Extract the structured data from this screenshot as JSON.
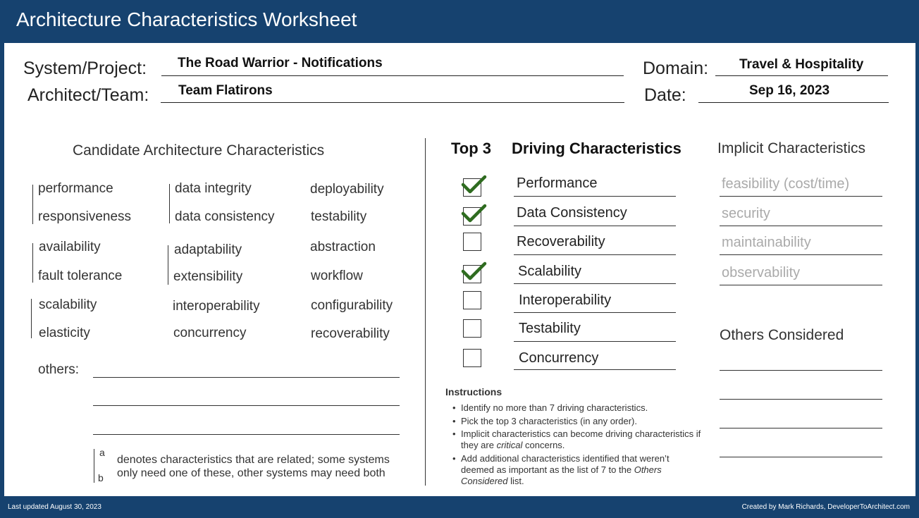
{
  "title": "Architecture Characteristics Worksheet",
  "header": {
    "system_label": "System/Project:",
    "system_value": "The Road Warrior -  Notifications",
    "team_label": "Architect/Team:",
    "team_value": "Team Flatirons",
    "domain_label": "Domain:",
    "domain_value": "Travel & Hospitality",
    "date_label": "Date:",
    "date_value": "Sep 16, 2023"
  },
  "candidate": {
    "heading": "Candidate Architecture Characteristics",
    "col1": [
      "performance",
      "responsiveness",
      "availability",
      "fault tolerance",
      "scalability",
      "elasticity"
    ],
    "col2": [
      "data integrity",
      "data consistency",
      "adaptability",
      "extensibility",
      "interoperability",
      "concurrency"
    ],
    "col3": [
      "deployability",
      "testability",
      "abstraction",
      "workflow",
      "configurability",
      "recoverability"
    ],
    "others_label": "others:",
    "legend_a": "a",
    "legend_b": "b",
    "legend_line1": "denotes characteristics that are related; some systems",
    "legend_line2": "only need one of these, other systems may need both"
  },
  "driving": {
    "top3_label": "Top 3",
    "heading": "Driving Characteristics",
    "items": [
      {
        "label": "Performance",
        "checked": true
      },
      {
        "label": "Data Consistency",
        "checked": true
      },
      {
        "label": "Recoverability",
        "checked": false
      },
      {
        "label": "Scalability",
        "checked": true
      },
      {
        "label": "Interoperability",
        "checked": false
      },
      {
        "label": "Testability",
        "checked": false
      },
      {
        "label": "Concurrency",
        "checked": false
      }
    ],
    "check_color": "#2e6b1f"
  },
  "implicit": {
    "heading": "Implicit Characteristics",
    "items": [
      "feasibility (cost/time)",
      "security",
      "maintainability",
      "observability"
    ],
    "others_heading": "Others Considered"
  },
  "instructions": {
    "title": "Instructions",
    "item1": "Identify no more than 7 driving characteristics.",
    "item2": "Pick the top 3 characteristics (in any order).",
    "item3_a": "Implicit characteristics can become driving characteristics if they are ",
    "item3_em": "critical",
    "item3_b": " concerns.",
    "item4_a": "Add additional characteristics identified that weren’t deemed as important as the list of 7 to the ",
    "item4_em": "Others Considered",
    "item4_b": " list."
  },
  "footer": {
    "left": "Last updated August 30, 2023",
    "right": "Created by Mark Richards, DeveloperToArchitect.com"
  },
  "colors": {
    "banner": "#16426f",
    "implicit_text": "#aaaaaa"
  }
}
